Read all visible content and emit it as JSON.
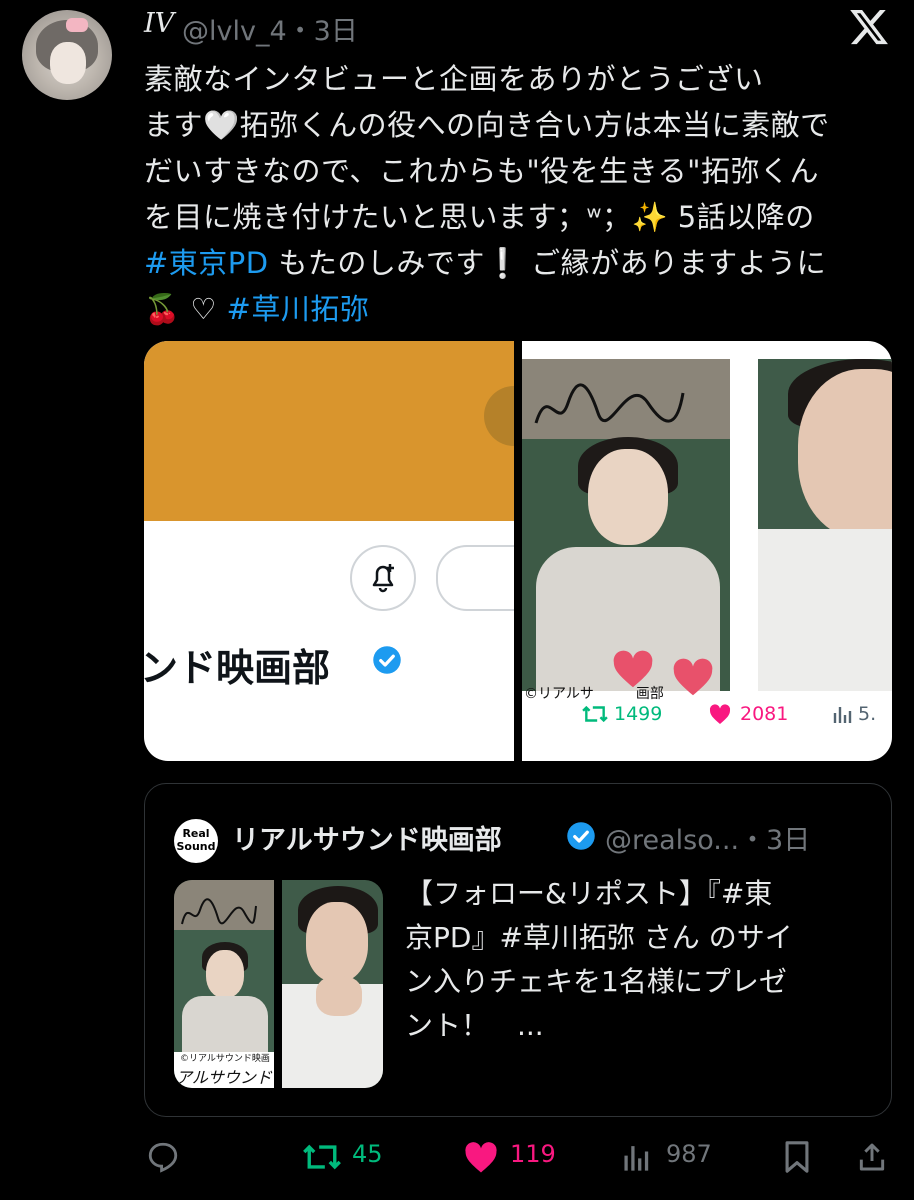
{
  "author": {
    "display_name": "𝐼𝑉",
    "handle_time": "@lvlv_4・3日"
  },
  "tweet": {
    "lines": [
      "素敵なインタビューと企画をありがとうござい",
      "ます🤍拓弥くんの役への向き合い方は本当に素敵で",
      "だいすきなので、これからも\"役を生きる\"拓弥くん",
      "を目に焼き付けたいと思います；ʷ；✨ 5話以降の"
    ],
    "line5_tag": "#東京PD",
    "line5_rest": " もたのしみです❕ ご縁がありますように",
    "line6_emoji": "🍒 ♡ ",
    "line6_tag": "#草川拓弥"
  },
  "media": {
    "channel_name": "ンド映画部",
    "photo_caption": "©リアルサ",
    "photo_caption_end": "画部",
    "retweets": "1499",
    "likes": "2081",
    "views": "5."
  },
  "quote": {
    "logo_line1": "Real",
    "logo_line2": "Sound",
    "name": "リアルサウンド映画部",
    "handle_time": "@realso...・3日",
    "lines": [
      "【フォロー&リポスト】『#東",
      "京PD』#草川拓弥 さん のサイ",
      "ン入りチェキを1名様にプレゼ",
      "ント！　..."
    ],
    "img_caption": "©リアルサウンド映画",
    "img_caption2": "アルサウンド"
  },
  "actions": {
    "retweets": "45",
    "likes": "119",
    "views": "987"
  },
  "colors": {
    "link": "#1d9bf0",
    "retweet": "#00ba7c",
    "like": "#f91880",
    "muted": "#71767b"
  }
}
